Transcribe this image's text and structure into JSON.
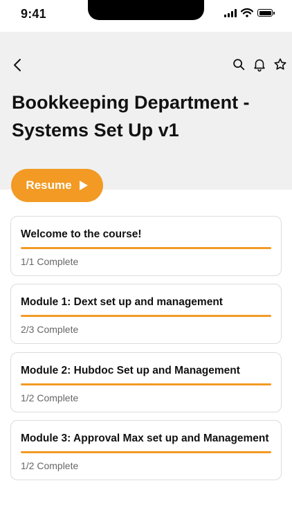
{
  "status_bar": {
    "time": "9:41"
  },
  "header": {
    "back_icon": "chevron-left-icon",
    "actions": [
      "search-icon",
      "bell-icon",
      "star-icon"
    ],
    "title": "Bookkeeping Department - Systems Set Up v1"
  },
  "resume_button": {
    "label": "Resume",
    "icon": "play-icon"
  },
  "colors": {
    "accent": "#F29A24",
    "header_bg": "#f0f0f0",
    "card_border": "#dcdcdc"
  },
  "modules": [
    {
      "title": "Welcome to the course!",
      "status": "1/1 Complete",
      "progress": 1.0
    },
    {
      "title": "Module 1: Dext set up and management",
      "status": "2/3 Complete",
      "progress": 1.0
    },
    {
      "title": "Module 2: Hubdoc Set up and Management",
      "status": "1/2 Complete",
      "progress": 1.0
    },
    {
      "title": "Module 3: Approval Max set up and Management",
      "status": "1/2 Complete",
      "progress": 1.0
    }
  ]
}
